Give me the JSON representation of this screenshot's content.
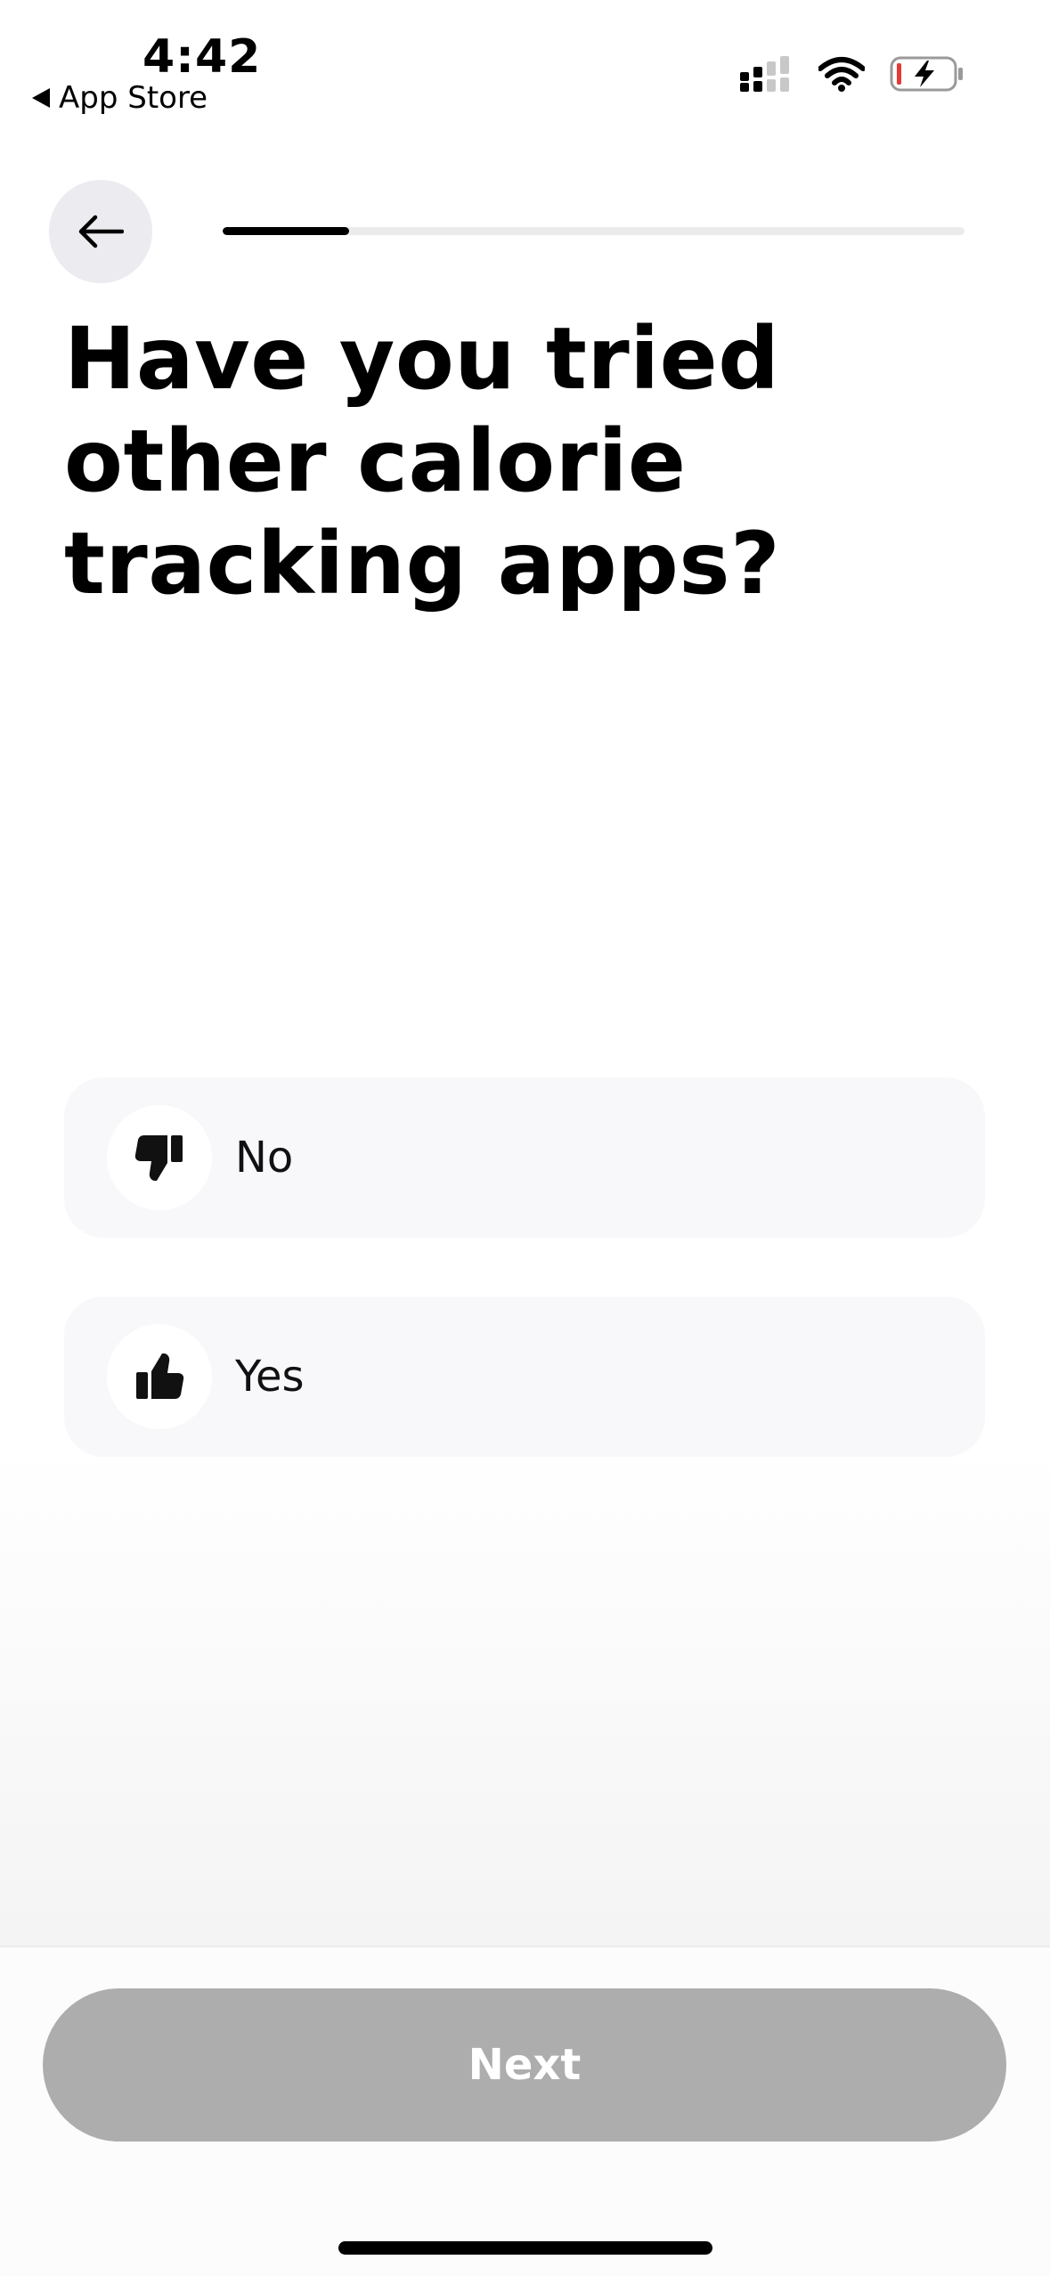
{
  "status_bar": {
    "time": "4:42",
    "back_app": "App Store"
  },
  "progress": {
    "fraction": 0.17
  },
  "question": {
    "title": "Have you tried other calorie tracking apps?"
  },
  "options": [
    {
      "label": "No",
      "icon": "thumbs-down-icon"
    },
    {
      "label": "Yes",
      "icon": "thumbs-up-icon"
    }
  ],
  "footer": {
    "next_label": "Next"
  },
  "colors": {
    "accent": "#000000",
    "option_background": "#f8f8fb",
    "button_disabled": "#adadad",
    "battery_low": "#e53935"
  }
}
